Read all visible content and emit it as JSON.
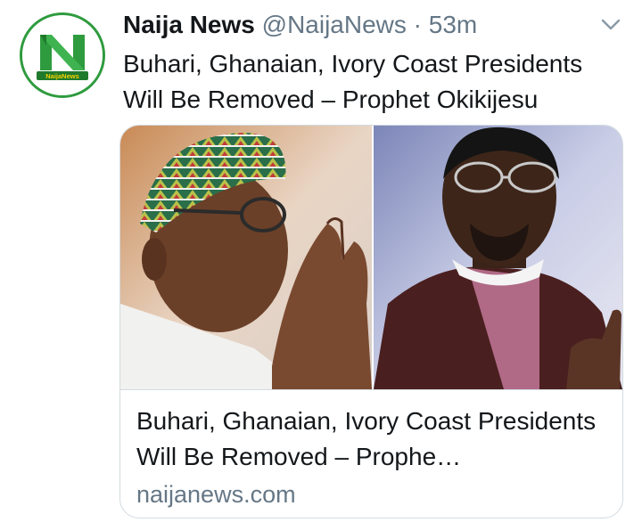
{
  "tweet": {
    "display_name": "Naija News",
    "handle": "@NaijaNews",
    "separator": "·",
    "time": "53m",
    "text": "Buhari, Ghanaian, Ivory Coast Presidents Will Be Removed – Prophet Okikijesu",
    "avatar": {
      "logo_text": "NaijaNews",
      "brand_color": "#2e9b3e"
    },
    "menu_icon": "chevron-down-icon"
  },
  "card": {
    "title": "Buhari, Ghanaian, Ivory Coast Presidents Will Be Removed – Prophe…",
    "domain": "naijanews.com",
    "image_description_icons": [
      "portrait-left",
      "portrait-right"
    ]
  },
  "colors": {
    "text_primary": "#14171a",
    "text_secondary": "#657786",
    "border": "#d3dbe1",
    "brand_green": "#2e9b3e"
  }
}
